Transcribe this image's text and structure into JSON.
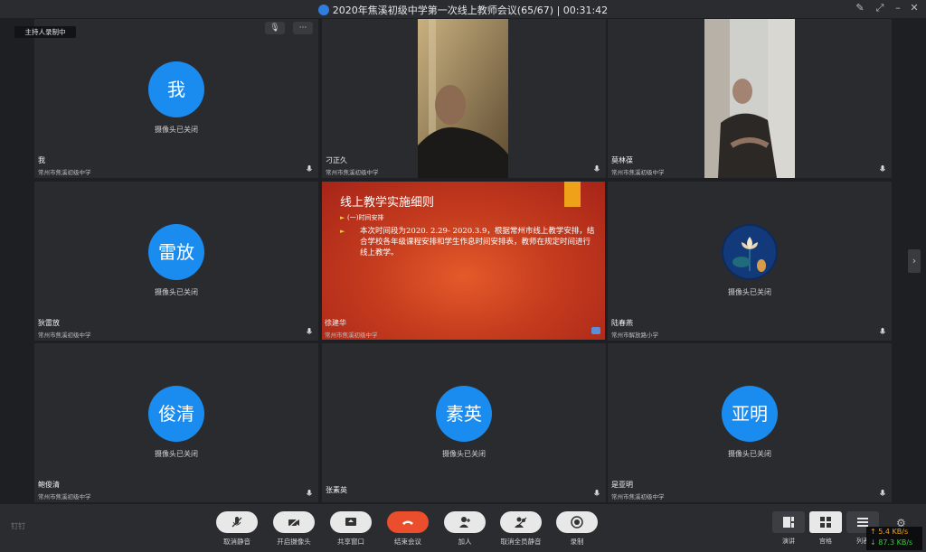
{
  "window": {
    "title": "2020年焦溪初级中学第一次线上教师会议(65/67) | 00:31:42"
  },
  "overlay": {
    "recording_tag": "主持人录制中",
    "more_label": "···"
  },
  "participants": [
    {
      "avatar": "我",
      "name": "我",
      "org": "常州市焦溪初级中学",
      "camera": "摄像头已关闭"
    },
    {
      "name": "刁正久",
      "org": "常州市焦溪初级中学"
    },
    {
      "name": "莫林葆",
      "org": "常州市焦溪初级中学"
    },
    {
      "avatar": "雷放",
      "name": "狄雷放",
      "org": "常州市焦溪初级中学",
      "camera": "摄像头已关闭"
    },
    {
      "name": "徐建华",
      "org": "常州市焦溪初级中学"
    },
    {
      "name": "陆春燕",
      "org": "常州市解放路小学",
      "camera": "摄像头已关闭"
    },
    {
      "avatar": "俊清",
      "name": "鲍俊清",
      "org": "常州市焦溪初级中学",
      "camera": "摄像头已关闭"
    },
    {
      "avatar": "素英",
      "name": "张素英",
      "org": "",
      "camera": "摄像头已关闭"
    },
    {
      "avatar": "亚明",
      "name": "是亚明",
      "org": "常州市焦溪初级中学",
      "camera": "摄像头已关闭"
    }
  ],
  "slide": {
    "title": "线上教学实施细则",
    "bullet1": "(一)时间安排",
    "paragraph": "本次时间段为2020. 2.29- 2020.3.9，根据常州市线上教学安排，结合学校各年级课程安排和学生作息时间安排表，教师在规定时间进行线上教学。"
  },
  "toolbar": {
    "brand": "钉钉",
    "buttons": [
      {
        "label": "取消静音",
        "icon": "mic-muted-icon"
      },
      {
        "label": "开启摄像头",
        "icon": "camera-off-icon"
      },
      {
        "label": "共享窗口",
        "icon": "share-screen-icon"
      },
      {
        "label": "结束会议",
        "icon": "hangup-icon"
      },
      {
        "label": "加人",
        "icon": "add-person-icon"
      },
      {
        "label": "取消全员静音",
        "icon": "mute-all-icon"
      },
      {
        "label": "录制",
        "icon": "record-icon"
      }
    ],
    "views": [
      {
        "label": "演讲",
        "icon": "speaker-view-icon"
      },
      {
        "label": "宫格",
        "icon": "grid-view-icon"
      },
      {
        "label": "列表",
        "icon": "list-view-icon"
      }
    ]
  },
  "network": {
    "upload": "5.4 KB/s",
    "download": "87.3 KB/s"
  },
  "colors": {
    "avatar_blue": "#1a8cf0",
    "hangup_red": "#ea4e2c",
    "upload_color": "#f0a11a",
    "download_color": "#3fc63f"
  }
}
